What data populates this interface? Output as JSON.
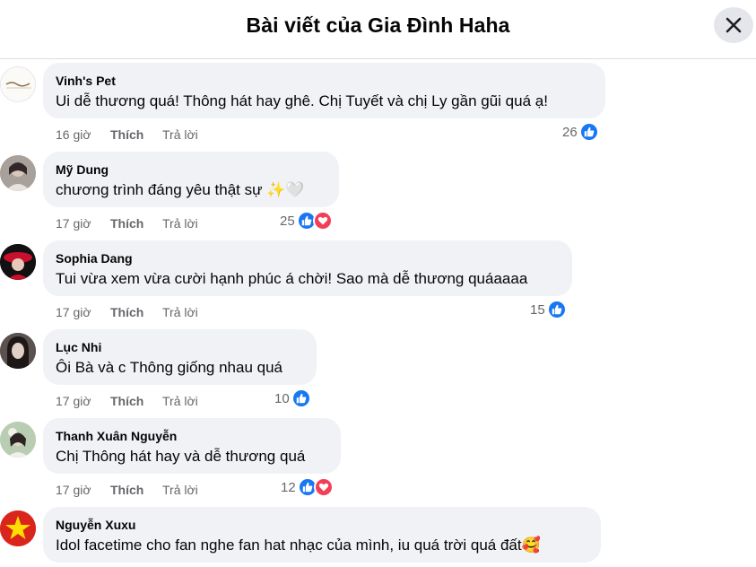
{
  "header": {
    "title": "Bài viết của Gia Đình Haha"
  },
  "labels": {
    "like": "Thích",
    "reply": "Trả lời"
  },
  "colors": {
    "like": "#1877f2",
    "love": "#f33e58",
    "bubble": "#f0f2f5",
    "meta": "#65676b"
  },
  "comments": [
    {
      "author": "Vinh's Pet",
      "text": "Ui dễ thương quá! Thông hát hay ghê. Chị Tuyết và chị Ly gần gũi quá ạ!",
      "time": "16 giờ",
      "reaction_count": "26",
      "reactions": [
        "like"
      ]
    },
    {
      "author": "Mỹ Dung",
      "text": "chương trình đáng yêu thật sự ✨🤍",
      "time": "17 giờ",
      "reaction_count": "25",
      "reactions": [
        "like",
        "love"
      ]
    },
    {
      "author": "Sophia Dang",
      "text": "Tui vừa xem vừa cười hạnh phúc á chời! Sao mà dễ thương quáaaaa",
      "time": "17 giờ",
      "reaction_count": "15",
      "reactions": [
        "like"
      ]
    },
    {
      "author": "Lục Nhi",
      "text": "Ôi Bà và c Thông giống nhau quá",
      "time": "17 giờ",
      "reaction_count": "10",
      "reactions": [
        "like"
      ]
    },
    {
      "author": "Thanh Xuân Nguyễn",
      "text": "Chị Thông hát hay và dễ thương quá",
      "time": "17 giờ",
      "reaction_count": "12",
      "reactions": [
        "like",
        "love"
      ]
    },
    {
      "author": "Nguyễn Xuxu",
      "text": "Idol facetime cho fan nghe fan hat nhạc của mình, iu quá trời quá đất🥰",
      "time": "",
      "reaction_count": "",
      "reactions": []
    }
  ]
}
